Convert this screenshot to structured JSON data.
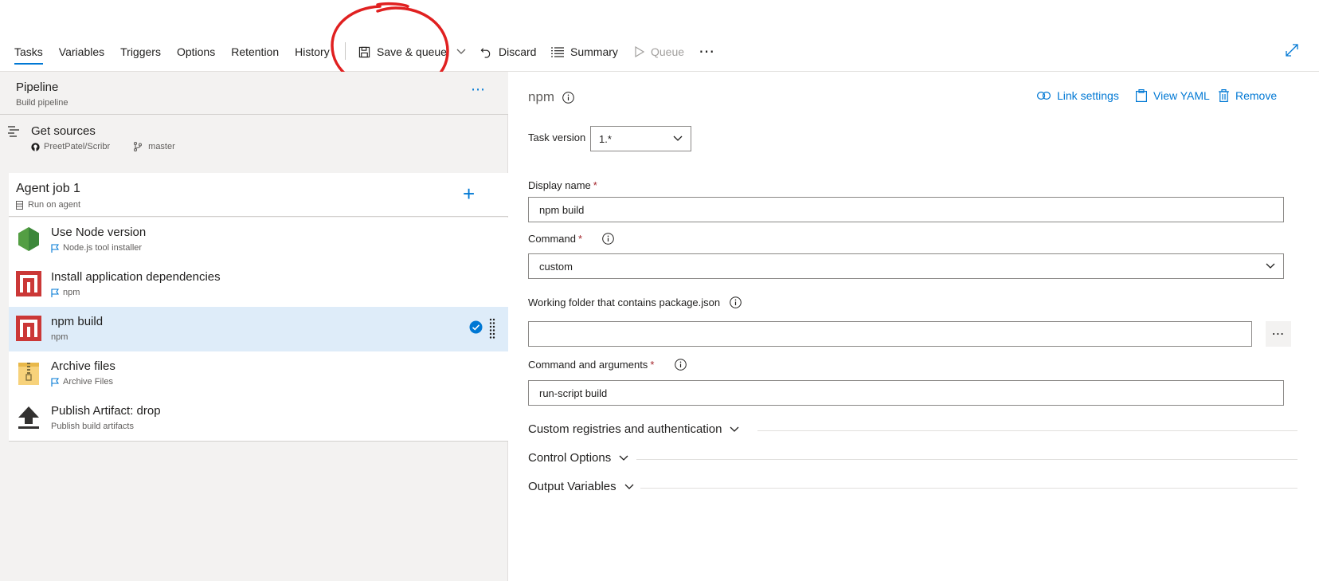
{
  "tabs": [
    "Tasks",
    "Variables",
    "Triggers",
    "Options",
    "Retention",
    "History"
  ],
  "toolbar": {
    "save_queue": "Save & queue",
    "discard": "Discard",
    "summary": "Summary",
    "queue": "Queue",
    "more": "⋯"
  },
  "pipeline": {
    "title": "Pipeline",
    "subtitle": "Build pipeline",
    "more": "⋯"
  },
  "sources": {
    "title": "Get sources",
    "repo": "PreetPatel/Scribr",
    "branch": "master"
  },
  "job": {
    "title": "Agent job 1",
    "subtitle": "Run on agent",
    "add": "+"
  },
  "tasks": [
    {
      "title": "Use Node version",
      "subtitle": "Node.js tool installer",
      "icon": "nodejs-icon",
      "flag": true
    },
    {
      "title": "Install application dependencies",
      "subtitle": "npm",
      "icon": "npm-icon",
      "flag": true
    },
    {
      "title": "npm build",
      "subtitle": "npm",
      "icon": "npm-icon",
      "flag": false,
      "selected": true
    },
    {
      "title": "Archive files",
      "subtitle": "Archive Files",
      "icon": "zip-archive-icon",
      "flag": true
    },
    {
      "title": "Publish Artifact: drop",
      "subtitle": "Publish build artifacts",
      "icon": "upload-arrow-icon",
      "flag": false
    }
  ],
  "detail": {
    "title": "npm",
    "link_settings": "Link settings",
    "view_yaml": "View YAML",
    "remove": "Remove",
    "task_version_label": "Task version",
    "task_version_value": "1.*",
    "display_name_label": "Display name",
    "display_name_value": "npm build",
    "command_label": "Command",
    "command_value": "custom",
    "working_folder_label": "Working folder that contains package.json",
    "working_folder_value": "",
    "command_args_label": "Command and arguments",
    "command_args_value": "run-script build",
    "browse": "⋯",
    "sections": [
      "Custom registries and authentication",
      "Control Options",
      "Output Variables"
    ]
  },
  "colors": {
    "accent": "#0078d4",
    "selected_row": "#deecf9",
    "required": "#a4262c",
    "annotation": "#e02020",
    "npm_red": "#cb3837",
    "node_green": "#539e43"
  }
}
